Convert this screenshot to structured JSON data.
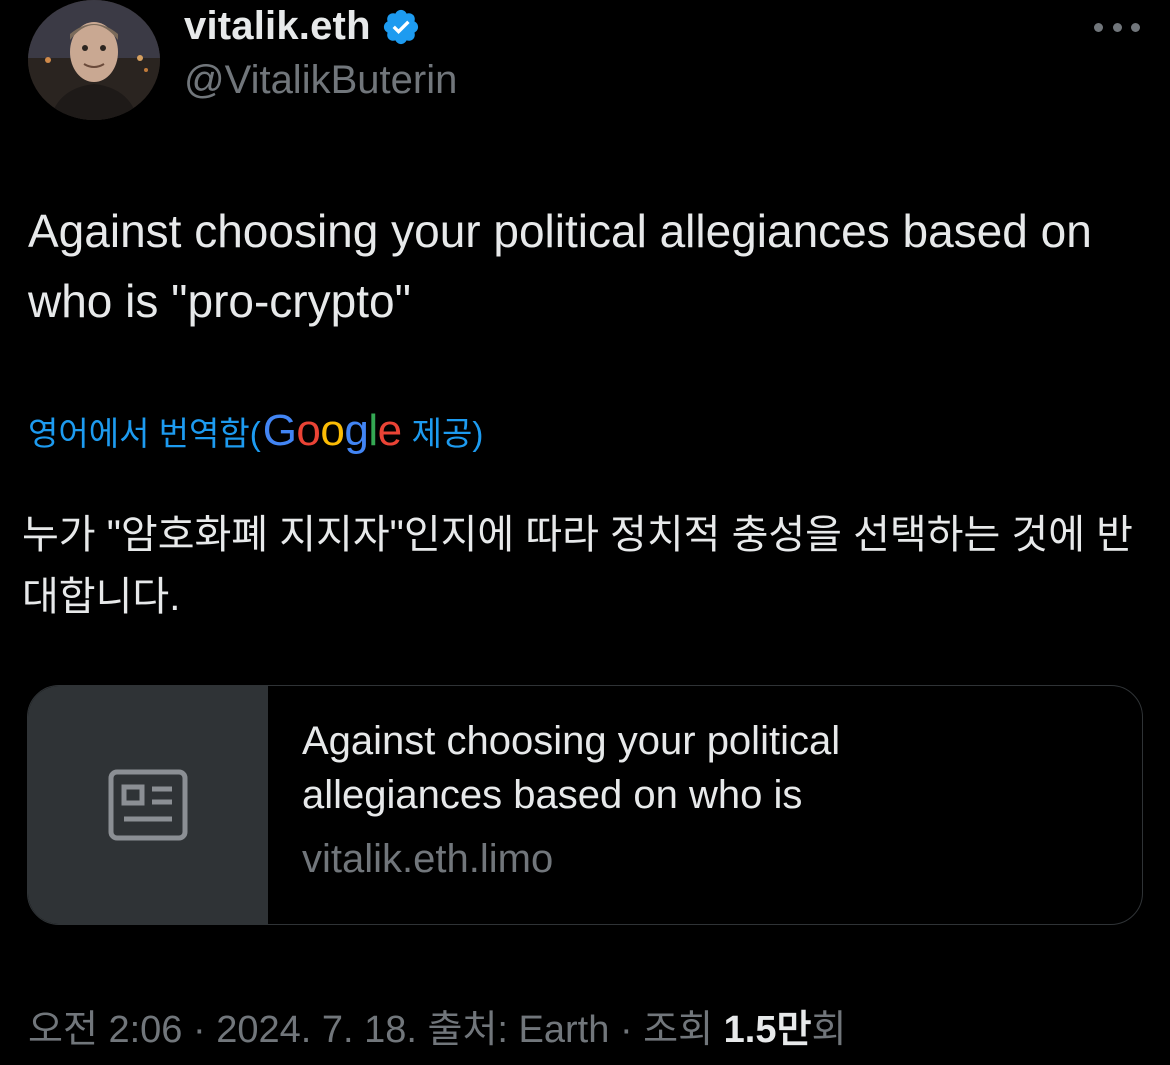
{
  "author": {
    "display_name": "vitalik.eth",
    "handle": "@VitalikButerin",
    "verified_color": "#1d9bf0"
  },
  "tweet": {
    "text": "Against choosing your political allegiances based on who is \"pro-crypto\""
  },
  "translation": {
    "prefix": "영어에서 번역함(",
    "provider": "Google",
    "suffix": " 제공)",
    "text": "누가 \"암호화폐 지지자\"인지에 따라 정치적 충성을 선택하는 것에 반대합니다."
  },
  "link_card": {
    "title": "Against choosing your political allegiances based on who is",
    "domain": "vitalik.eth.limo",
    "icon": "article-icon"
  },
  "meta": {
    "time": "오전 2:06",
    "date": "2024. 7. 18.",
    "source_label": "출처: Earth",
    "views_label": "조회",
    "views_count": "1.5만",
    "views_suffix": "회"
  },
  "colors": {
    "background": "#000000",
    "text_primary": "#e7e9ea",
    "text_secondary": "#71767b",
    "link": "#1d9bf0",
    "card_border": "#2f3336"
  }
}
